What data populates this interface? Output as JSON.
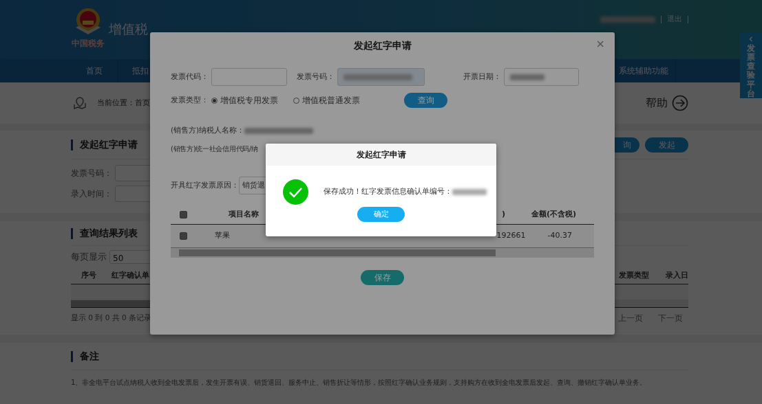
{
  "header": {
    "logo_caption": "中国税务",
    "title": "增值税",
    "user_links": [
      "退出"
    ]
  },
  "nav": [
    "首页",
    "抵扣",
    "系统辅助功能"
  ],
  "side_tab": {
    "label": "发票查验平台"
  },
  "breadcrumb": {
    "label": "当前位置：首页",
    "help": "帮助"
  },
  "apply_section": {
    "title": "发起红字申请",
    "fields": [
      {
        "label": "发票号码："
      },
      {
        "label": "录入时间："
      }
    ],
    "buttons": [
      "询",
      "发起"
    ]
  },
  "results_section": {
    "title": "查询结果列表",
    "page_size_label": "每页显示",
    "page_size": "50",
    "columns": [
      "序号",
      "红字确认单",
      "发票类型",
      "录入日"
    ],
    "summary": "显示 0 到 0 共 0 条记录",
    "pager": [
      "上一页",
      "下一页"
    ]
  },
  "notes": {
    "title": "备注",
    "items": [
      "1、非全电平台试点纳税人收到全电发票后，发生开票有误、销货退回、服务中止、销售折让等情形，按照红字确认业务规则，支持购方在收到全电发票后发起、查询、撤销红字确认单业务。"
    ]
  },
  "modal": {
    "title": "发起红字申请",
    "close": "×",
    "fields": [
      {
        "label": "发票代码：",
        "redacted": false,
        "autofilled": false
      },
      {
        "label": "发票号码：",
        "redacted": true,
        "autofilled": true
      },
      {
        "label": "开票日期：",
        "redacted": true,
        "autofilled": false
      }
    ],
    "invoice_type_label": "发票类型：",
    "invoice_types": [
      {
        "label": "增值税专用发票",
        "selected": true
      },
      {
        "label": "增值税普通发票",
        "selected": false
      }
    ],
    "query_button": "查询",
    "seller_name_label": "(销售方)纳税人名称：",
    "seller_code_label": "(销售方)统一社会信用代码/纳",
    "reason_label": "开具红字发票原因：",
    "reason_value": "销货退",
    "table": {
      "header_checked": true,
      "columns": [
        "项目名称",
        ")",
        "金额(不含税)"
      ],
      "rows": [
        {
          "checked": true,
          "cells": [
            "苹果",
            "192661",
            "-40.37"
          ]
        }
      ]
    },
    "save_button": "保存"
  },
  "dialog": {
    "title": "发起红字申请",
    "message": "保存成功！红字发票信息确认单编号：",
    "ok_button": "确定"
  }
}
